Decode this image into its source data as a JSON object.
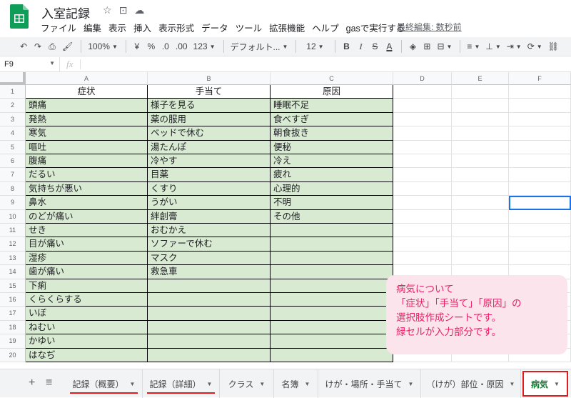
{
  "header": {
    "title": "入室記録",
    "menu": [
      "ファイル",
      "編集",
      "表示",
      "挿入",
      "表示形式",
      "データ",
      "ツール",
      "拡張機能",
      "ヘルプ",
      "gasで実行する"
    ],
    "last_edit": "最終編集: 数秒前"
  },
  "toolbar": {
    "zoom": "100%",
    "currency": "¥",
    "percent": "%",
    "dec_less": ".0",
    "dec_more": ".00",
    "format_more": "123",
    "font": "デフォルト...",
    "font_size": "12",
    "bold": "B",
    "italic": "I",
    "strike": "S",
    "text_color": "A"
  },
  "formula_bar": {
    "cell_ref": "F9",
    "fx": "fx",
    "value": ""
  },
  "columns": [
    "A",
    "B",
    "C",
    "D",
    "E",
    "F"
  ],
  "rows": [
    "1",
    "2",
    "3",
    "4",
    "5",
    "6",
    "7",
    "8",
    "9",
    "10",
    "11",
    "12",
    "13",
    "14",
    "15",
    "16",
    "17",
    "18",
    "19",
    "20"
  ],
  "table": {
    "headers": [
      "症状",
      "手当て",
      "原因"
    ],
    "symptoms": [
      "頭痛",
      "発熱",
      "寒気",
      "嘔吐",
      "腹痛",
      "だるい",
      "気持ちが悪い",
      "鼻水",
      "のどが痛い",
      "せき",
      "目が痛い",
      "湿疹",
      "歯が痛い",
      "下痢",
      "くらくらする",
      "いぼ",
      "ねむい",
      "かゆい",
      "はなぢ"
    ],
    "treatments": [
      "様子を見る",
      "薬の服用",
      "ベッドで休む",
      "湯たんぽ",
      "冷やす",
      "目薬",
      "くすり",
      "うがい",
      "絆創膏",
      "おむかえ",
      "ソファーで休む",
      "マスク",
      "救急車",
      "",
      "",
      "",
      "",
      "",
      ""
    ],
    "causes": [
      "睡眠不足",
      "食べすぎ",
      "朝食抜き",
      "便秘",
      "冷え",
      "疲れ",
      "心理的",
      "不明",
      "その他",
      "",
      "",
      "",
      "",
      "",
      "",
      "",
      "",
      "",
      ""
    ]
  },
  "note": {
    "lines": [
      "病気について",
      "「症状」「手当て」「原因」の",
      "選択肢作成シートです。",
      "緑セルが入力部分です。"
    ],
    "color": "#e91e63",
    "background": "#fce4ec"
  },
  "sheet_tabs": [
    "記録（概要）",
    "記録（詳細）",
    "クラス",
    "名簿",
    "けが・場所・手当て",
    "（けが）部位・原因",
    "病気"
  ],
  "active_tab": "病気",
  "colors": {
    "cell_green": "#d9ead3",
    "highlight_red": "#e21c1c",
    "selection": "#1a73e8"
  }
}
